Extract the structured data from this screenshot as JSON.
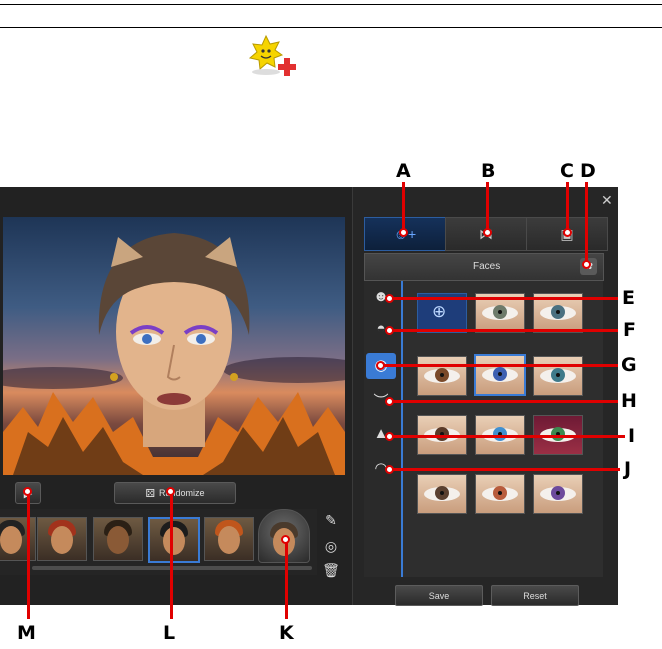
{
  "window": {
    "close_glyph": "✕"
  },
  "panel": {
    "section_title": "Faces",
    "tabs": [
      "head-add-tab",
      "accessory-tab",
      "background-tab"
    ],
    "categories": [
      "face",
      "hair",
      "eyes",
      "eyebrows",
      "nose",
      "lips"
    ],
    "eye_irises": [
      "#6d7a6a",
      "#4b7080",
      "#7a4a2a",
      "#3d5fb0",
      "#3e7a8a",
      "#5a3a28",
      "#3f8fd0",
      "#3c8a50",
      "#b85c3c",
      "#6d4a9c"
    ]
  },
  "toolbar": {
    "play_glyph": "▶",
    "randomize_label": "Randomize"
  },
  "footer": {
    "save_label": "Save",
    "reset_label": "Reset"
  },
  "callouts": {
    "A": "A",
    "B": "B",
    "C": "C",
    "D": "D",
    "E": "E",
    "F": "F",
    "G": "G",
    "H": "H",
    "I": "I",
    "J": "J",
    "K": "K",
    "L": "L",
    "M": "M"
  },
  "colors": {
    "accent": "#3a7bd5",
    "callout_line": "#e00000"
  }
}
